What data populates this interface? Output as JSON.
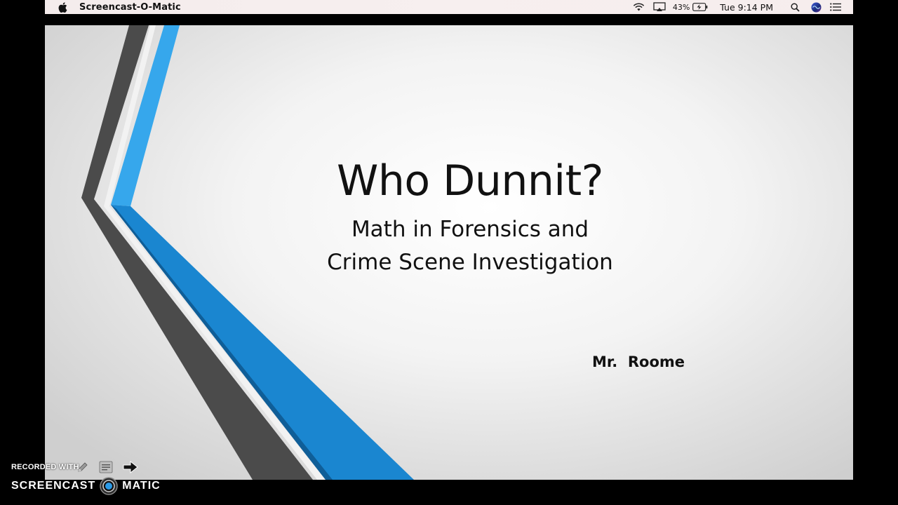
{
  "menubar": {
    "app_name": "Screencast-O-Matic",
    "icons": [
      "apple-icon",
      "wifi-icon",
      "airplay-icon",
      "battery-charging-icon",
      "spotlight-search-icon",
      "siri-icon",
      "notification-center-icon"
    ],
    "battery_percent": "43%",
    "clock": "Tue 9:14 PM"
  },
  "slide": {
    "title": "Who Dunnit?",
    "subtitle_line1": "Math in Forensics and",
    "subtitle_line2": "Crime Scene Investigation",
    "author": "Mr.  Roome",
    "colors": {
      "dark_stripe": "#4a4a4a",
      "blue_stripe": "#2e9be0",
      "blue_stripe_dark": "#1580c8"
    }
  },
  "watermark": {
    "recorded_with": "RECORDED WITH",
    "brand_left": "SCREENCAST",
    "brand_right": "MATIC",
    "icons": [
      "pencil-icon",
      "notes-icon",
      "arrow-right-icon",
      "record-logo-icon"
    ]
  }
}
